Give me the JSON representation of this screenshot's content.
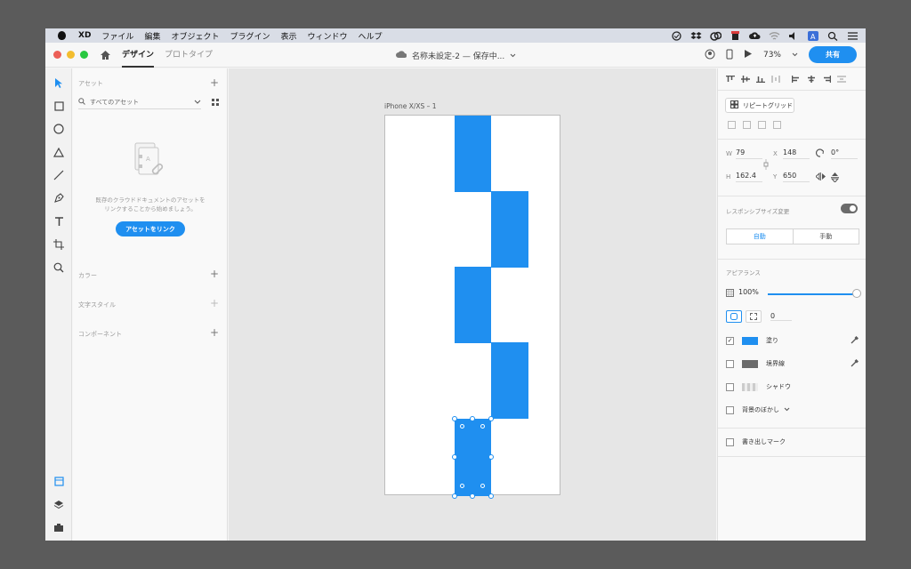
{
  "menubar": {
    "items": [
      "XD",
      "ファイル",
      "編集",
      "オブジェクト",
      "プラグイン",
      "表示",
      "ウィンドウ",
      "ヘルプ"
    ]
  },
  "titlebar": {
    "tabs": [
      "デザイン",
      "プロトタイプ"
    ],
    "doc_title": "名称未設定-2 — 保存中...",
    "zoom": "73%",
    "share_label": "共有"
  },
  "assets": {
    "header": "アセット",
    "search_placeholder": "すべてのアセット",
    "empty_message_line1": "既存のクラウドドキュメントのアセットを",
    "empty_message_line2": "リンクすることから始めましょう。",
    "link_button": "アセットをリンク",
    "colors_label": "カラー",
    "char_styles_label": "文字スタイル",
    "components_label": "コンポーネント"
  },
  "canvas": {
    "artboard_name": "iPhone X/XS – 1"
  },
  "properties": {
    "repeat_grid": "リピートグリッド",
    "w_label": "W",
    "w_value": "79",
    "h_label": "H",
    "h_value": "162.4",
    "x_label": "X",
    "x_value": "148",
    "y_label": "Y",
    "y_value": "650",
    "rotation_value": "0°",
    "responsive_label": "レスポンシブサイズ変更",
    "auto_label": "自動",
    "manual_label": "手動",
    "appearance_label": "アピアランス",
    "opacity_value": "100%",
    "radius_value": "0",
    "fill_label": "塗り",
    "fill_color": "#1f8ff0",
    "border_label": "境界線",
    "border_color": "#6b6b6b",
    "shadow_label": "シャドウ",
    "bg_blur_label": "背景のぼかし",
    "export_mark_label": "書き出しマーク"
  },
  "colors": {
    "accent": "#1f8ff0",
    "close": "#ec5f57",
    "minimize": "#f3bd2f",
    "maximize": "#28c840"
  }
}
